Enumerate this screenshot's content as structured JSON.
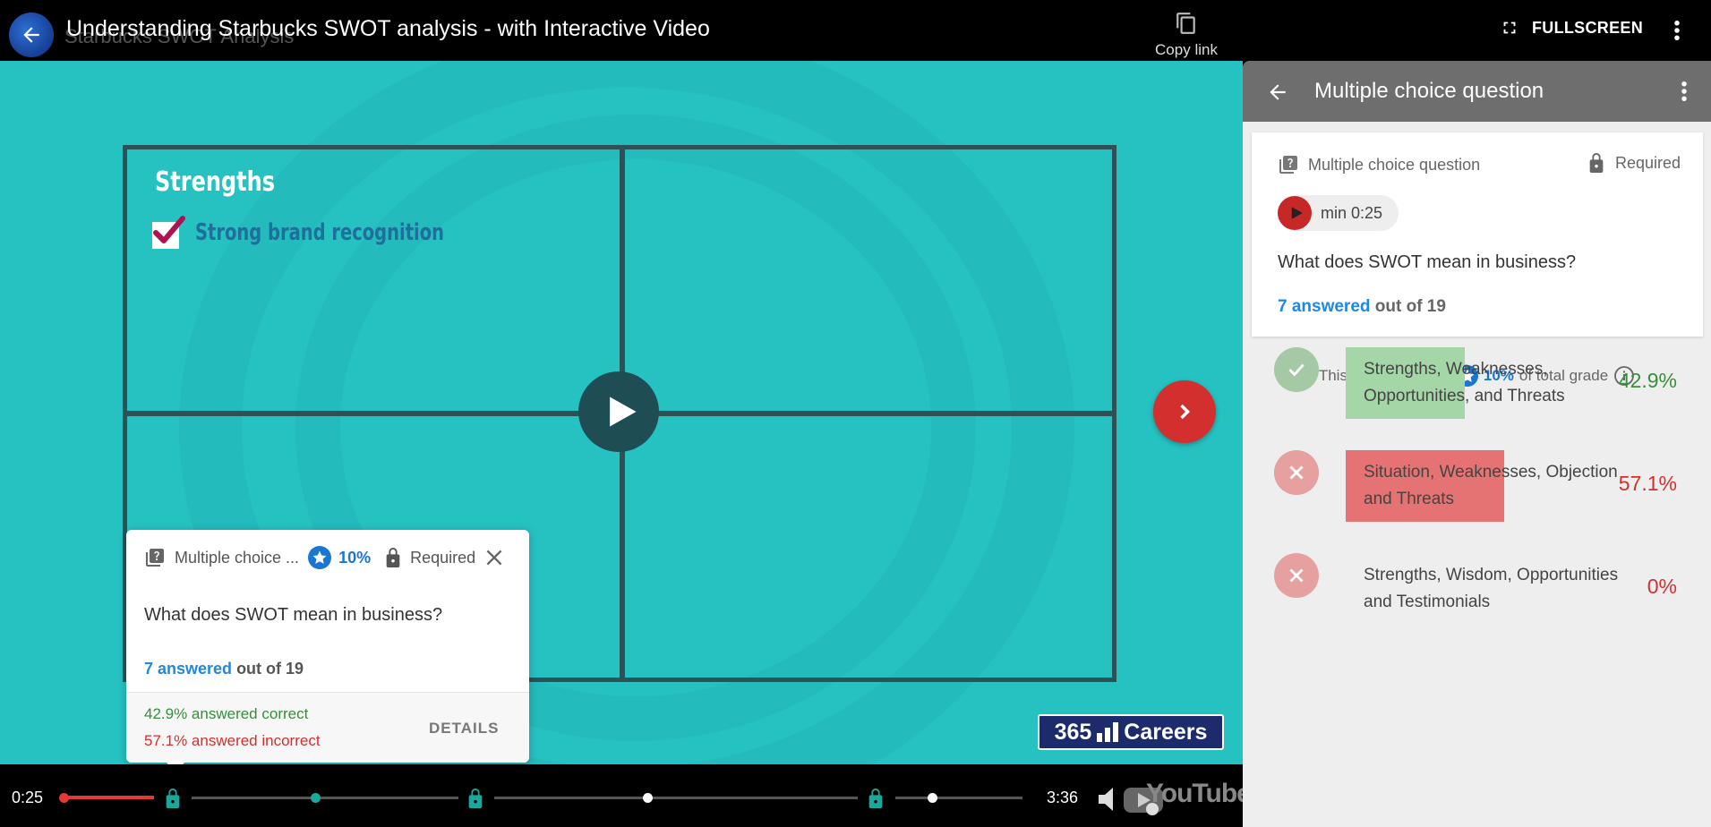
{
  "topbar": {
    "ghost_title": "Starbucks SWOT Analysis",
    "title": "Understanding Starbucks SWOT analysis - with Interactive Video",
    "copy_link": "Copy link",
    "fullscreen": "FULLSCREEN"
  },
  "slide": {
    "heading": "Strengths",
    "item": "Strong brand recognition",
    "logo_text_a": "365",
    "logo_text_b": "Careers"
  },
  "qcard": {
    "type_label": "Multiple choice ...",
    "grade_pct": "10%",
    "required": "Required",
    "question": "What does SWOT mean in business?",
    "answered_count": "7 answered",
    "answered_total": " out of 19",
    "correct_text": "42.9% answered correct",
    "incorrect_text": "57.1% answered incorrect",
    "details": "DETAILS"
  },
  "player": {
    "current_time": "0:25",
    "duration": "3:36",
    "progress_fraction": 0.116,
    "youtube_word": "YouTube"
  },
  "panel": {
    "title": "Multiple choice question",
    "type_label": "Multiple choice question",
    "required": "Required",
    "timestamp": "min 0:25",
    "question": "What does SWOT mean in business?",
    "answered_count": "7 answered",
    "answered_total": " out of 19",
    "offer_prefix": "This question offers",
    "offer_pct": "10%",
    "offer_suffix": "of total grade",
    "options": [
      {
        "text": "Strengths, Weaknesses, Opportunities, and Threats",
        "pct": "42.9%",
        "fraction": 0.429,
        "correct": true
      },
      {
        "text": "Situation, Weaknesses, Objection and Threats",
        "pct": "57.1%",
        "fraction": 0.571,
        "correct": false
      },
      {
        "text": "Strengths, Wisdom, Opportunities and Testimonials",
        "pct": "0%",
        "fraction": 0.0,
        "correct": false
      }
    ]
  },
  "colors": {
    "video_bg": "#26c2c2",
    "accent_red": "#d32f2f",
    "accent_blue": "#1976d2",
    "correct_green": "#388e3c",
    "panel_header": "#6e6e6e"
  }
}
